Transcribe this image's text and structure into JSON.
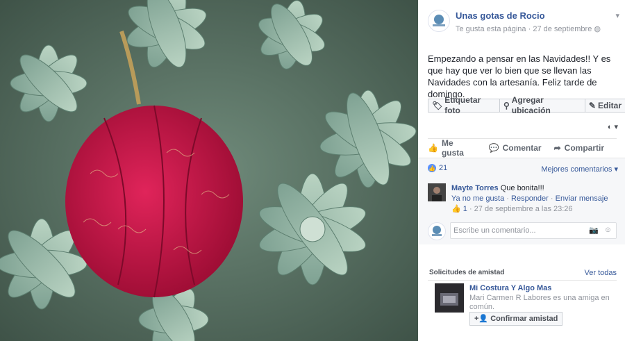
{
  "photo": {
    "subject": "red-fabric-christmas-ornament-on-succulents"
  },
  "post": {
    "page_name": "Unas gotas de Rocio",
    "likes_page": "Te gusta esta página",
    "date": "27 de septiembre",
    "text": "Empezando a pensar en las Navidades!! Y es que hay que ver lo bien que se llevan las Navidades con la artesanía. Feliz tarde de domingo.",
    "tag_buttons": [
      "Etiquetar foto",
      "Agregar ubicación",
      "Editar"
    ],
    "actions": {
      "like": "Me gusta",
      "comment": "Comentar",
      "share": "Compartir"
    },
    "like_count": "21",
    "sort_label": "Mejores comentarios"
  },
  "comment": {
    "author": "Mayte Torres",
    "text": "Que bonita!!!",
    "unlike": "Ya no me gusta",
    "reply": "Responder",
    "message": "Enviar mensaje",
    "likes": "1",
    "time": "27 de septiembre a las 23:26"
  },
  "composer": {
    "placeholder": "Escribe un comentario..."
  },
  "friend_requests": {
    "title": "Solicitudes de amistad",
    "see_all": "Ver todas",
    "name": "Mi Costura Y Algo Mas",
    "mutual": "Mari Carmen R Labores es una amiga en común.",
    "confirm": "Confirmar amistad"
  },
  "colors": {
    "link": "#365899",
    "like_blue": "#5890ff",
    "ornament_red": "#c8103f"
  }
}
